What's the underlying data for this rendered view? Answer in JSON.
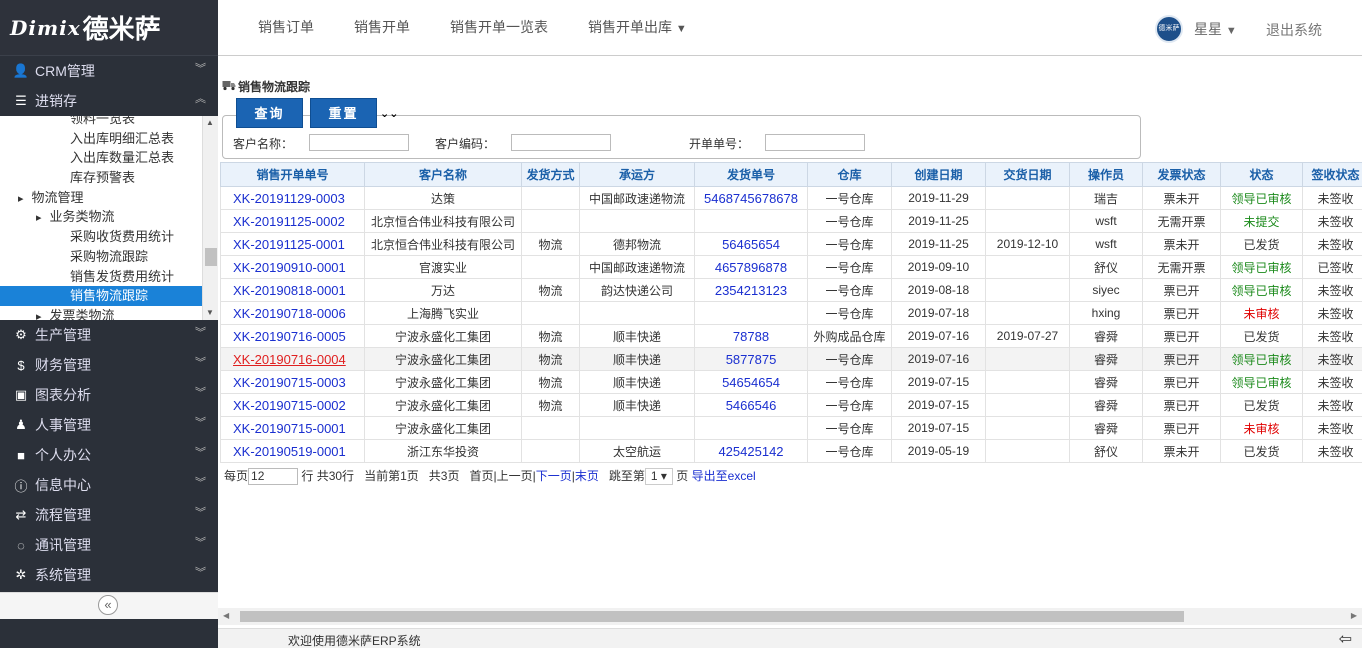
{
  "logo": {
    "brand": "Dimix",
    "cn": "德米萨"
  },
  "sidebar": {
    "top_items": [
      {
        "label": "CRM管理",
        "icon": "user-icon"
      },
      {
        "label": "进销存",
        "icon": "list-icon"
      }
    ],
    "submenu": [
      {
        "label": "领料一览表",
        "indent": 70
      },
      {
        "label": "入出库明细汇总表",
        "indent": 70
      },
      {
        "label": "入出库数量汇总表",
        "indent": 70
      },
      {
        "label": "库存预警表",
        "indent": 70
      },
      {
        "label": "物流管理",
        "indent": 18,
        "arrow": "▸"
      },
      {
        "label": "业务类物流",
        "indent": 36,
        "arrow": "▸"
      },
      {
        "label": "采购收货费用统计",
        "indent": 70
      },
      {
        "label": "采购物流跟踪",
        "indent": 70
      },
      {
        "label": "销售发货费用统计",
        "indent": 70
      },
      {
        "label": "销售物流跟踪",
        "indent": 70,
        "active": true
      },
      {
        "label": "发票类物流",
        "indent": 36,
        "arrow": "▸"
      }
    ],
    "bottom_items": [
      {
        "label": "生产管理",
        "icon": "gears-icon"
      },
      {
        "label": "财务管理",
        "icon": "dollar-icon"
      },
      {
        "label": "图表分析",
        "icon": "image-icon"
      },
      {
        "label": "人事管理",
        "icon": "person-icon"
      },
      {
        "label": "个人办公",
        "icon": "briefcase-icon"
      },
      {
        "label": "信息中心",
        "icon": "info-icon"
      },
      {
        "label": "流程管理",
        "icon": "exchange-icon"
      },
      {
        "label": "通讯管理",
        "icon": "chat-icon"
      },
      {
        "label": "系统管理",
        "icon": "cog-icon"
      }
    ]
  },
  "topnav": {
    "links": [
      "销售订单",
      "销售开单",
      "销售开单一览表",
      "销售开单出库"
    ],
    "user": "星星",
    "avatar_text": "德米萨",
    "logout": "退出系统"
  },
  "page": {
    "title": "销售物流跟踪",
    "query_btn": "查询",
    "reset_btn": "重置",
    "filters": {
      "customer_name": "客户名称：",
      "customer_code": "客户编码：",
      "bill_no": "开单单号："
    }
  },
  "table": {
    "headers": [
      "销售开单单号",
      "客户名称",
      "发货方式",
      "承运方",
      "发货单号",
      "仓库",
      "创建日期",
      "交货日期",
      "操作员",
      "发票状态",
      "状态",
      "签收状态"
    ],
    "rows": [
      [
        "XK-20191129-0003",
        "达策",
        "",
        "中国邮政速递物流",
        "5468745678678",
        "一号仓库",
        "2019-11-29",
        "",
        "瑞吉",
        "票未开",
        "领导已审核",
        "未签收"
      ],
      [
        "XK-20191125-0002",
        "北京恒合伟业科技有限公司",
        "",
        "",
        "",
        "一号仓库",
        "2019-11-25",
        "",
        "wsft",
        "无需开票",
        "未提交",
        "未签收"
      ],
      [
        "XK-20191125-0001",
        "北京恒合伟业科技有限公司",
        "物流",
        "德邦物流",
        "56465654",
        "一号仓库",
        "2019-11-25",
        "2019-12-10",
        "wsft",
        "票未开",
        "已发货",
        "未签收"
      ],
      [
        "XK-20190910-0001",
        "官渡实业",
        "",
        "中国邮政速递物流",
        "4657896878",
        "一号仓库",
        "2019-09-10",
        "",
        "舒仪",
        "无需开票",
        "领导已审核",
        "已签收"
      ],
      [
        "XK-20190818-0001",
        "万达",
        "物流",
        "韵达快递公司",
        "2354213123",
        "一号仓库",
        "2019-08-18",
        "",
        "siyec",
        "票已开",
        "领导已审核",
        "未签收"
      ],
      [
        "XK-20190718-0006",
        "上海腾飞实业",
        "",
        "",
        "",
        "一号仓库",
        "2019-07-18",
        "",
        "hxing",
        "票已开",
        "未审核",
        "未签收"
      ],
      [
        "XK-20190716-0005",
        "宁波永盛化工集团",
        "物流",
        "顺丰快递",
        "78788",
        "外购成品仓库",
        "2019-07-16",
        "2019-07-27",
        "睿舜",
        "票已开",
        "已发货",
        "未签收"
      ],
      [
        "XK-20190716-0004",
        "宁波永盛化工集团",
        "物流",
        "顺丰快递",
        "5877875",
        "一号仓库",
        "2019-07-16",
        "",
        "睿舜",
        "票已开",
        "领导已审核",
        "未签收"
      ],
      [
        "XK-20190715-0003",
        "宁波永盛化工集团",
        "物流",
        "顺丰快递",
        "54654654",
        "一号仓库",
        "2019-07-15",
        "",
        "睿舜",
        "票已开",
        "领导已审核",
        "未签收"
      ],
      [
        "XK-20190715-0002",
        "宁波永盛化工集团",
        "物流",
        "顺丰快递",
        "5466546",
        "一号仓库",
        "2019-07-15",
        "",
        "睿舜",
        "票已开",
        "已发货",
        "未签收"
      ],
      [
        "XK-20190715-0001",
        "宁波永盛化工集团",
        "",
        "",
        "",
        "一号仓库",
        "2019-07-15",
        "",
        "睿舜",
        "票已开",
        "未审核",
        "未签收"
      ],
      [
        "XK-20190519-0001",
        "浙江东华投资",
        "",
        "太空航运",
        "425425142",
        "一号仓库",
        "2019-05-19",
        "",
        "舒仪",
        "票未开",
        "已发货",
        "未签收"
      ]
    ]
  },
  "pager": {
    "per_page_label": "每页",
    "per_page": "12",
    "total": "行 共30行",
    "current": "当前第1页",
    "pages": "共3页",
    "first": "首页",
    "prev": "上一页",
    "next": "下一页",
    "last": "末页",
    "jump": "跳至第",
    "jump_val": "1 ▾",
    "page_unit": "页",
    "export": "导出至excel"
  },
  "status_bar": {
    "message": "欢迎使用德米萨ERP系统"
  },
  "colors": {
    "sidebar": "#2b3039",
    "accent": "#1a82d8",
    "button": "#1b64b3",
    "link": "#1a2fd0",
    "approved": "#1b8a1b",
    "unapproved": "#e00000"
  }
}
